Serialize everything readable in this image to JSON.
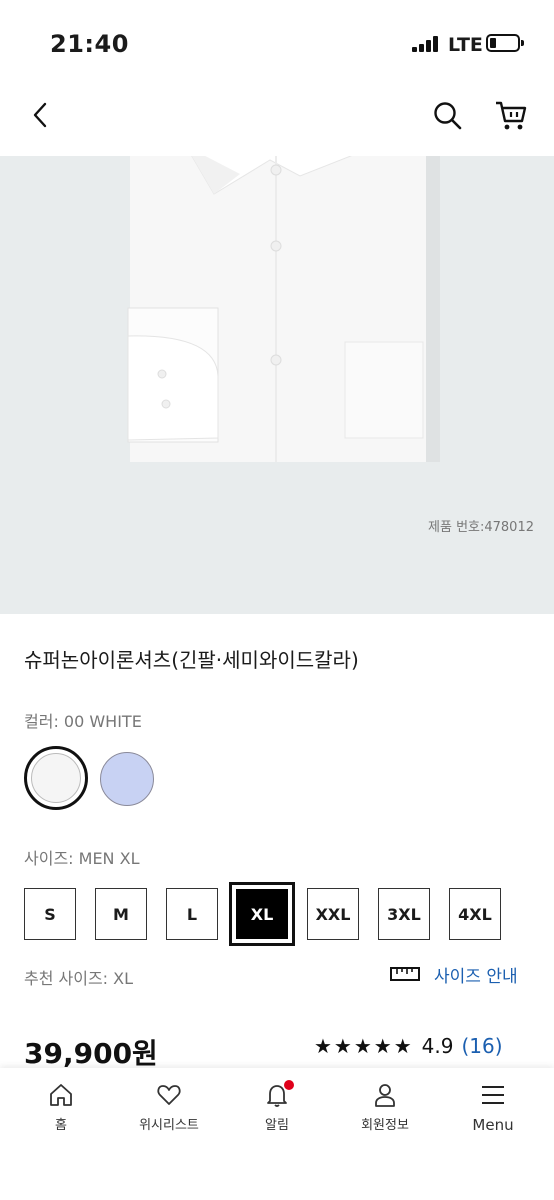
{
  "status_bar": {
    "time": "21:40",
    "network": "LTE",
    "battery_level": 0.15
  },
  "header": {
    "back_icon": "chevron-left-icon",
    "search_icon": "search-icon",
    "cart_icon": "cart-icon"
  },
  "product": {
    "product_number": "제품 번호:478012",
    "title": "슈퍼논아이론셔츠(긴팔·세미와이드칼라)",
    "color_label": "컬러: 00 WHITE",
    "colors": [
      {
        "name": "00 WHITE",
        "hex": "#f5f5f5",
        "selected": true
      },
      {
        "name": "blue",
        "hex": "#c8d2f3",
        "selected": false
      }
    ],
    "size_label": "사이즈: MEN XL",
    "sizes": [
      "S",
      "M",
      "L",
      "XL",
      "XXL",
      "3XL",
      "4XL"
    ],
    "selected_size": "XL",
    "recommended_size": "추천 사이즈: XL",
    "size_guide_label": "사이즈 안내",
    "price": "39,900원",
    "rating": {
      "stars": "★★★★★",
      "score": "4.9",
      "count": "(16)",
      "value": 4.9
    }
  },
  "bottom_nav": {
    "items": [
      {
        "label": "홈",
        "icon": "home-icon"
      },
      {
        "label": "위시리스트",
        "icon": "heart-icon"
      },
      {
        "label": "알림",
        "icon": "bell-icon"
      },
      {
        "label": "회원정보",
        "icon": "user-icon"
      },
      {
        "label": "Menu",
        "icon": "menu-icon"
      }
    ]
  },
  "colors": {
    "accent_link": "#1b5fb0",
    "notification_dot": "#e0001a",
    "hero_bg": "#e8eced"
  }
}
